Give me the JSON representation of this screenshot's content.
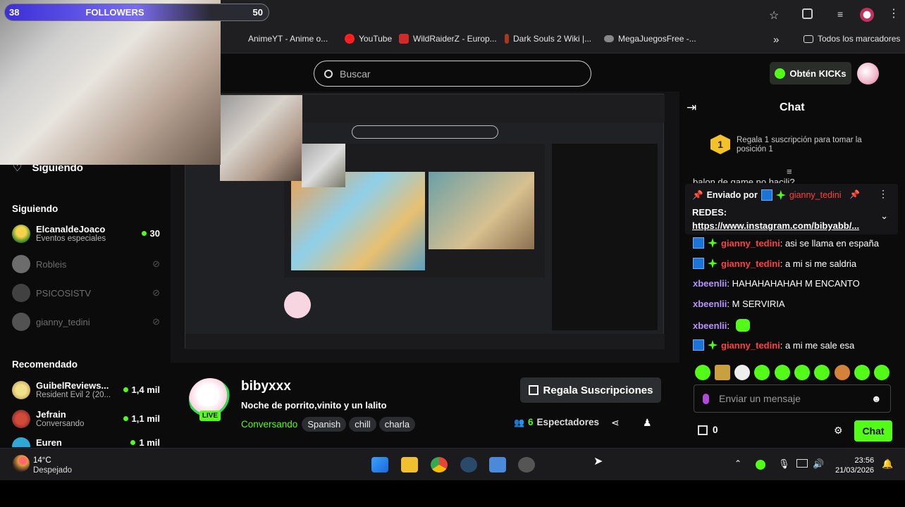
{
  "overlay": {
    "followers_label": "FOLLOWERS",
    "followers_current": "38",
    "followers_goal": "50"
  },
  "bookmarks": [
    {
      "label": "AnimeYT - Anime o...",
      "color": "#6a4ee0"
    },
    {
      "label": "YouTube",
      "color": "#ff1f1f"
    },
    {
      "label": "WildRaiderZ - Europ...",
      "color": "#d02b2b"
    },
    {
      "label": "Dark Souls 2 Wiki |...",
      "color": "#a33a1e"
    },
    {
      "label": "MegaJuegosFree -...",
      "color": "#8a8a8a"
    }
  ],
  "bookmarks_overflow": "»",
  "all_bookmarks": "Todos los marcadores",
  "search": {
    "placeholder": "Buscar"
  },
  "header": {
    "kicks_label": "Obtén KICKs"
  },
  "sidebar": {
    "top_label": "Siguiendo",
    "following_title": "Siguiendo",
    "following": [
      {
        "name": "ElcanaldeJoaco",
        "sub": "Eventos especiales",
        "viewers": "30",
        "live": true
      },
      {
        "name": "Robleis",
        "live": false
      },
      {
        "name": "PSICOSISTV",
        "live": false
      },
      {
        "name": "gianny_tedini",
        "live": false
      }
    ],
    "recommended_title": "Recomendado",
    "recommended": [
      {
        "name": "GuibelReviews...",
        "sub": "Resident Evil 2 (20...",
        "viewers": "1,4 mil"
      },
      {
        "name": "Jefrain",
        "sub": "Conversando",
        "viewers": "1,1 mil"
      },
      {
        "name": "Euren",
        "sub": "",
        "viewers": "1 mil"
      }
    ]
  },
  "stream": {
    "channel": "bibyxxx",
    "title": "Noche de porrito,vinito y un lalito",
    "category": "Conversando",
    "tags": [
      "Spanish",
      "chill",
      "charla"
    ],
    "live_badge": "LIVE",
    "viewers_count": "6",
    "viewers_label": "Espectadores",
    "gift_label": "Regala Suscripciones"
  },
  "chat": {
    "title": "Chat",
    "promo_rank": "1",
    "promo_text_1": "Regala 1 suscripción para tomar la",
    "promo_text_2": "posición 1",
    "cut_text": "balon de game no hacili?",
    "pinned_by": "Enviado por",
    "pinned_user": "gianny_tedini",
    "pinned_label": "REDES:",
    "pinned_link": "https://www.instagram.com/bibyabb/...",
    "messages": [
      {
        "user": "gianny_tedini",
        "text": ": asi se llama en españa",
        "badges": true
      },
      {
        "user": "gianny_tedini",
        "text": ": a mi si me saldria",
        "badges": true
      },
      {
        "user": "xbeenlii",
        "text": ": HAHAHAHAHAH M ENCANTO",
        "badges": false
      },
      {
        "user": "xbeenlii",
        "text": ": M SERVIRIA",
        "badges": false
      },
      {
        "user": "xbeenlii",
        "text": ":",
        "badges": false
      },
      {
        "user": "gianny_tedini",
        "text": ": a mi me sale esa",
        "badges": true
      }
    ],
    "input_placeholder": "Enviar un mensaje",
    "kicks_count": "0",
    "send_label": "Chat"
  },
  "taskbar": {
    "temp": "14°C",
    "weather": "Despejado",
    "time": "23:56",
    "date": "21/03/2026"
  },
  "colors": {
    "accent": "#53fc18",
    "red_user": "#ff4040",
    "purple_user": "#b892ff"
  }
}
